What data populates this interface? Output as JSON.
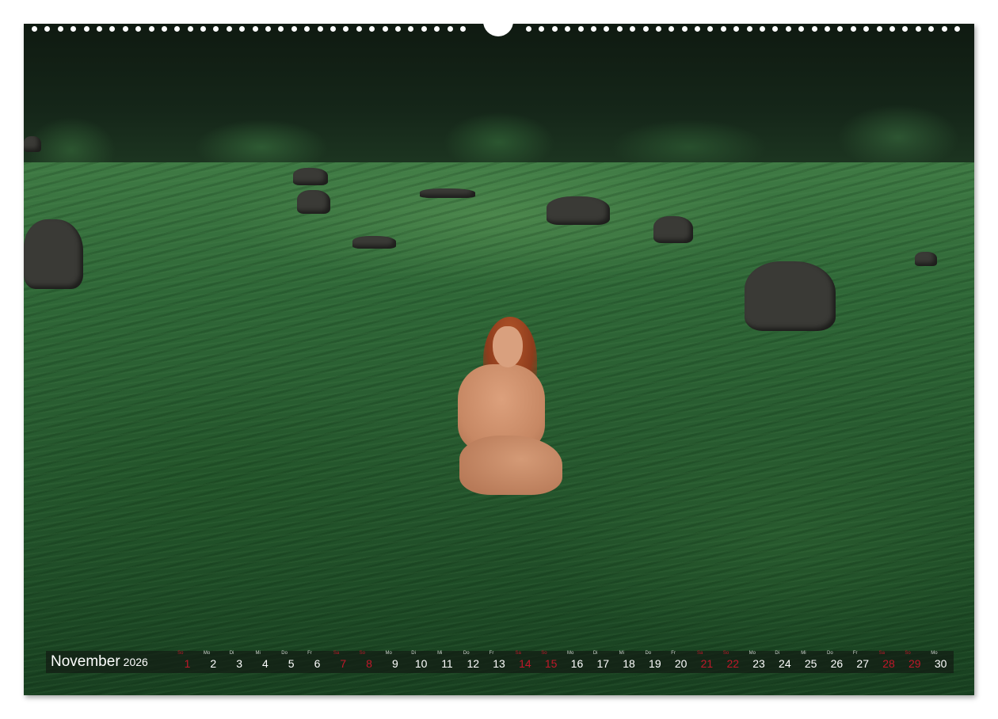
{
  "calendar": {
    "month": "November",
    "year": "2026",
    "days": [
      {
        "wd": "So",
        "num": "1",
        "holiday": true
      },
      {
        "wd": "Mo",
        "num": "2",
        "holiday": false
      },
      {
        "wd": "Di",
        "num": "3",
        "holiday": false
      },
      {
        "wd": "Mi",
        "num": "4",
        "holiday": false
      },
      {
        "wd": "Do",
        "num": "5",
        "holiday": false
      },
      {
        "wd": "Fr",
        "num": "6",
        "holiday": false
      },
      {
        "wd": "Sa",
        "num": "7",
        "holiday": true
      },
      {
        "wd": "So",
        "num": "8",
        "holiday": true
      },
      {
        "wd": "Mo",
        "num": "9",
        "holiday": false
      },
      {
        "wd": "Di",
        "num": "10",
        "holiday": false
      },
      {
        "wd": "Mi",
        "num": "11",
        "holiday": false
      },
      {
        "wd": "Do",
        "num": "12",
        "holiday": false
      },
      {
        "wd": "Fr",
        "num": "13",
        "holiday": false
      },
      {
        "wd": "Sa",
        "num": "14",
        "holiday": true
      },
      {
        "wd": "So",
        "num": "15",
        "holiday": true
      },
      {
        "wd": "Mo",
        "num": "16",
        "holiday": false
      },
      {
        "wd": "Di",
        "num": "17",
        "holiday": false
      },
      {
        "wd": "Mi",
        "num": "18",
        "holiday": false
      },
      {
        "wd": "Do",
        "num": "19",
        "holiday": false
      },
      {
        "wd": "Fr",
        "num": "20",
        "holiday": false
      },
      {
        "wd": "Sa",
        "num": "21",
        "holiday": true
      },
      {
        "wd": "So",
        "num": "22",
        "holiday": true
      },
      {
        "wd": "Mo",
        "num": "23",
        "holiday": false
      },
      {
        "wd": "Di",
        "num": "24",
        "holiday": false
      },
      {
        "wd": "Mi",
        "num": "25",
        "holiday": false
      },
      {
        "wd": "Do",
        "num": "26",
        "holiday": false
      },
      {
        "wd": "Fr",
        "num": "27",
        "holiday": false
      },
      {
        "wd": "Sa",
        "num": "28",
        "holiday": true
      },
      {
        "wd": "So",
        "num": "29",
        "holiday": true
      },
      {
        "wd": "Mo",
        "num": "30",
        "holiday": false
      }
    ]
  },
  "colors": {
    "holiday": "#c0182a",
    "strip": "#121c14",
    "grass": "#2f6737"
  }
}
